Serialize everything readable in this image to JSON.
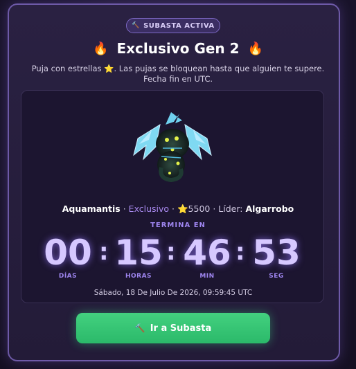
{
  "badge": {
    "icon": "hammer-icon",
    "label": "SUBASTA ACTIVA"
  },
  "title": {
    "text": "Exclusivo Gen 2",
    "icon": "fire-icon"
  },
  "subtitle": {
    "before_star": "Puja con estrellas",
    "after_star": ". Las pujas se bloquean hasta que alguien te supere. Fecha fin en UTC.",
    "icon": "star-icon"
  },
  "item": {
    "name": "Aquamantis",
    "sep1": " · ",
    "rarity": "Exclusivo",
    "sep2": " · ",
    "price": "5500",
    "sep3": " · ",
    "leader_label": "Líder:",
    "leader": "Algarrobo"
  },
  "countdown": {
    "label": "TERMINA EN",
    "days": {
      "value": "00",
      "label": "DÍAS"
    },
    "hours": {
      "value": "15",
      "label": "HORAS"
    },
    "minutes": {
      "value": "46",
      "label": "MIN"
    },
    "seconds": {
      "value": "53",
      "label": "SEG"
    },
    "separator": ":"
  },
  "end_date": "Sábado, 18 De Julio De 2026, 09:59:45 UTC",
  "cta": {
    "icon": "hammer-icon",
    "label": "Ir a Subasta"
  },
  "colors": {
    "accent": "#9f86f0",
    "timer": "#d6c8ff",
    "button": "#3cc777",
    "star": "#f5c518",
    "fire": "#ff6a1f"
  }
}
